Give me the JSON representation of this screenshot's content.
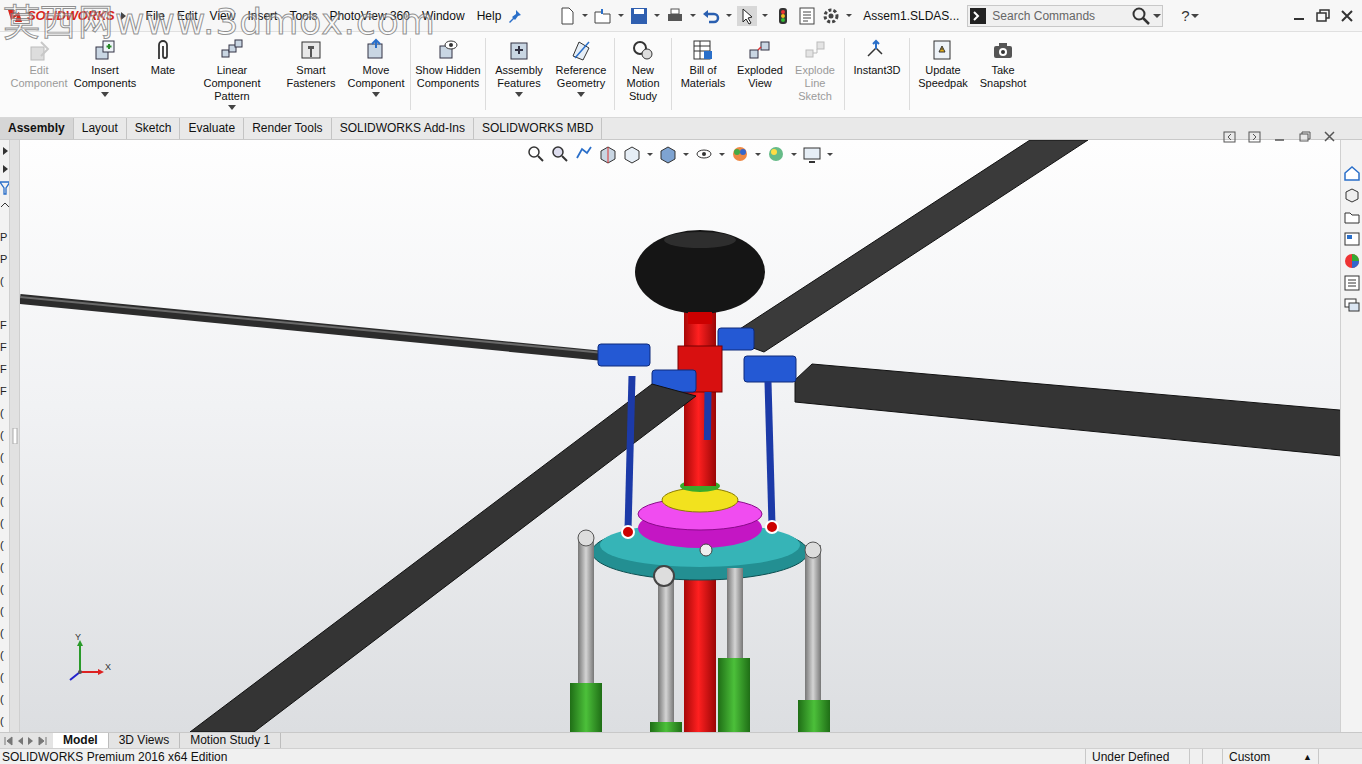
{
  "watermark": "莫西网www.3dmox.com",
  "title_bar": {
    "logo": "SOLIDWORKS",
    "menus": [
      "File",
      "Edit",
      "View",
      "Insert",
      "Tools",
      "PhotoView 360",
      "Window",
      "Help"
    ],
    "document": "Assem1.SLDAS...",
    "search": {
      "placeholder": "Search Commands"
    },
    "help": "?"
  },
  "command_manager": {
    "buttons": [
      {
        "label": "Edit Component",
        "disabled": true,
        "dropdown": false
      },
      {
        "label": "Insert Components",
        "disabled": false,
        "dropdown": true
      },
      {
        "label": "Mate",
        "disabled": false,
        "dropdown": false
      },
      {
        "label": "Linear Component Pattern",
        "disabled": false,
        "dropdown": true
      },
      {
        "label": "Smart Fasteners",
        "disabled": false,
        "dropdown": false
      },
      {
        "label": "Move Component",
        "disabled": false,
        "dropdown": true
      },
      {
        "label": "Show Hidden Components",
        "disabled": false,
        "dropdown": false
      },
      {
        "label": "Assembly Features",
        "disabled": false,
        "dropdown": true
      },
      {
        "label": "Reference Geometry",
        "disabled": false,
        "dropdown": true
      },
      {
        "label": "New Motion Study",
        "disabled": false,
        "dropdown": false
      },
      {
        "label": "Bill of Materials",
        "disabled": false,
        "dropdown": false
      },
      {
        "label": "Exploded View",
        "disabled": false,
        "dropdown": false
      },
      {
        "label": "Explode Line Sketch",
        "disabled": true,
        "dropdown": false
      },
      {
        "label": "Instant3D",
        "disabled": false,
        "dropdown": false
      },
      {
        "label": "Update Speedpak",
        "disabled": false,
        "dropdown": false
      },
      {
        "label": "Take Snapshot",
        "disabled": false,
        "dropdown": false
      }
    ]
  },
  "tabs": [
    {
      "label": "Assembly",
      "selected": true
    },
    {
      "label": "Layout",
      "selected": false
    },
    {
      "label": "Sketch",
      "selected": false
    },
    {
      "label": "Evaluate",
      "selected": false
    },
    {
      "label": "Render Tools",
      "selected": false
    },
    {
      "label": "SOLIDWORKS Add-Ins",
      "selected": false
    },
    {
      "label": "SOLIDWORKS MBD",
      "selected": false
    }
  ],
  "feature_tree": {
    "items": [
      "P",
      "P",
      "(",
      "",
      "F",
      "F",
      "F",
      "F",
      "(",
      "(",
      "(",
      "(",
      "(",
      "(",
      "(",
      "(",
      "(",
      "(",
      "(",
      "(",
      "(",
      "(",
      "("
    ]
  },
  "triad": {
    "y": "Y",
    "x": "X"
  },
  "bottom_tabs": [
    {
      "label": "Model",
      "selected": true
    },
    {
      "label": "3D Views",
      "selected": false
    },
    {
      "label": "Motion Study 1",
      "selected": false
    }
  ],
  "status_bar": {
    "edition": "SOLIDWORKS Premium 2016 x64 Edition",
    "state": "Under Defined",
    "units": "Custom",
    "units_arrow": "▲"
  }
}
